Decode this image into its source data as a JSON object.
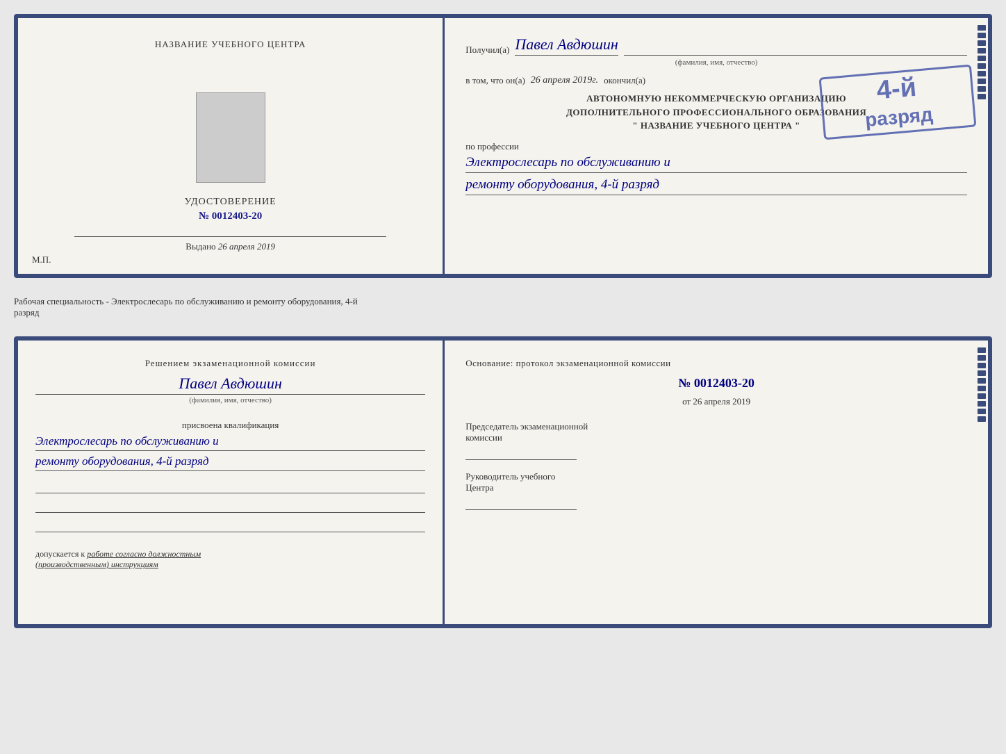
{
  "topLeft": {
    "centerLabel": "НАЗВАНИЕ УЧЕБНОГО ЦЕНТРА",
    "docTitle": "УДОСТОВЕРЕНИЕ",
    "docNumber": "№ 0012403-20",
    "выданоPrefix": "Выдано",
    "выданоDate": "26 апреля 2019",
    "mpLabel": "М.П."
  },
  "topRight": {
    "получилPrefix": "Получил(а)",
    "recipientName": "Павел Авдюшин",
    "фиоLabel": "(фамилия, имя, отчество)",
    "вТомЧтоPrefix": "в том, что он(а)",
    "completionDate": "26 апреля 2019г.",
    "окончилLabel": "окончил(а)",
    "stampText": "4-й\nразряд",
    "orgLine1": "АВТОНОМНУЮ НЕКОММЕРЧЕСКУЮ ОРГАНИЗАЦИЮ",
    "orgLine2": "ДОПОЛНИТЕЛЬНОГО ПРОФЕССИОНАЛЬНОГО ОБРАЗОВАНИЯ",
    "orgLine3": "\" НАЗВАНИЕ УЧЕБНОГО ЦЕНТРА \"",
    "поПрофессии": "по профессии",
    "prof1": "Электрослесарь по обслуживанию и",
    "prof2": "ремонту оборудования, 4-й разряд"
  },
  "middleText": "Рабочая специальность - Электрослесарь по обслуживанию и ремонту оборудования, 4-й\nразряд",
  "bottomLeft": {
    "решениемText": "Решением экзаменационной комиссии",
    "recipientName": "Павел Авдюшин",
    "фиоLabel": "(фамилия, имя, отчество)",
    "присвоенаText": "присвоена квалификация",
    "qual1": "Электрослесарь по обслуживанию и",
    "qual2": "ремонту оборудования, 4-й разряд",
    "допускается": "допускается к",
    "допускаетсяValue": "работе согласно должностным\n(производственным) инструкциям"
  },
  "bottomRight": {
    "основаниеText": "Основание: протокол экзаменационной комиссии",
    "номерLabel": "№  0012403-20",
    "отPrefix": "от",
    "отDate": "26 апреля 2019",
    "председательTitle": "Председатель экзаменационной\nкомиссии",
    "руководительTitle": "Руководитель учебного\nЦентра"
  }
}
